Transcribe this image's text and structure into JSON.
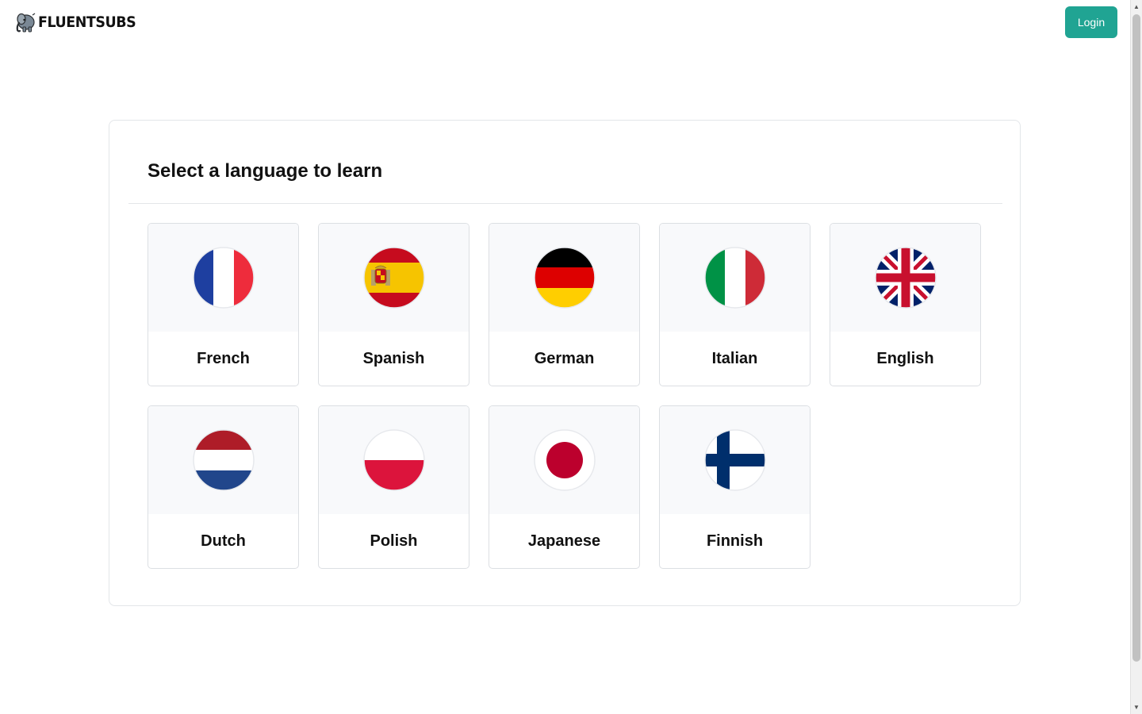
{
  "header": {
    "logo_text": "FLUENTSUBS",
    "logo_icon": "elephant-mascot-icon",
    "login_label": "Login"
  },
  "colors": {
    "accent": "#20a493",
    "tile_top_bg": "#f8f9fb",
    "border": "#e3e6e9"
  },
  "main": {
    "title": "Select a language to learn",
    "languages": [
      {
        "label": "French",
        "flag": "france-flag-icon"
      },
      {
        "label": "Spanish",
        "flag": "spain-flag-icon"
      },
      {
        "label": "German",
        "flag": "germany-flag-icon"
      },
      {
        "label": "Italian",
        "flag": "italy-flag-icon"
      },
      {
        "label": "English",
        "flag": "uk-flag-icon"
      },
      {
        "label": "Dutch",
        "flag": "netherlands-flag-icon"
      },
      {
        "label": "Polish",
        "flag": "poland-flag-icon"
      },
      {
        "label": "Japanese",
        "flag": "japan-flag-icon"
      },
      {
        "label": "Finnish",
        "flag": "finland-flag-icon"
      }
    ]
  }
}
